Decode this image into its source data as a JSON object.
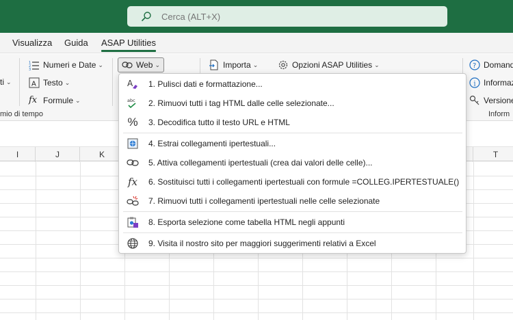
{
  "search": {
    "placeholder": "Cerca (ALT+X)"
  },
  "tabs": [
    {
      "label": "Visualizza"
    },
    {
      "label": "Guida"
    },
    {
      "label": "ASAP Utilities"
    }
  ],
  "ribbon": {
    "numbers_dates": "Numeri e Date",
    "text": "Testo",
    "formulas": "Formule",
    "web": "Web",
    "import": "Importa",
    "options": "Opzioni ASAP Utilities",
    "ask": "Domand",
    "info": "Informaz",
    "version": "Versione",
    "left_cut_chev": "ti",
    "group_time": "mio di tempo",
    "group_info": "Inform"
  },
  "columns": [
    "I",
    "J",
    "K",
    "T"
  ],
  "menu": {
    "items": [
      {
        "label": "1. Pulisci dati e formattazione...",
        "icon": "eraser-icon"
      },
      {
        "label": "2. Rimuovi tutti i tag HTML dalle celle selezionate...",
        "icon": "spellcheck-icon"
      },
      {
        "label": "3. Decodifica tutto il testo URL e HTML",
        "icon": "percent-icon"
      },
      {
        "label": "4. Estrai collegamenti ipertestuali...",
        "icon": "globe-page-icon"
      },
      {
        "label": "5. Attiva collegamenti ipertestuali (crea dai valori delle celle)...",
        "icon": "link-icon"
      },
      {
        "label": "6. Sostituisci tutti i collegamenti ipertestuali con formule =COLLEG.IPERTESTUALE()",
        "icon": "fx-icon"
      },
      {
        "label": "7. Rimuovi tutti i collegamenti ipertestuali nelle celle selezionate",
        "icon": "broken-link-icon"
      },
      {
        "label": "8. Esporta selezione come tabella HTML negli appunti",
        "icon": "clipboard-export-icon"
      },
      {
        "label": "9. Visita il nostro sito per maggiori suggerimenti relativi a Excel",
        "icon": "globe-icon"
      }
    ]
  },
  "colors": {
    "brand": "#1e6e42",
    "accent": "#7b3fc4",
    "link_blue": "#1f6fc2"
  }
}
